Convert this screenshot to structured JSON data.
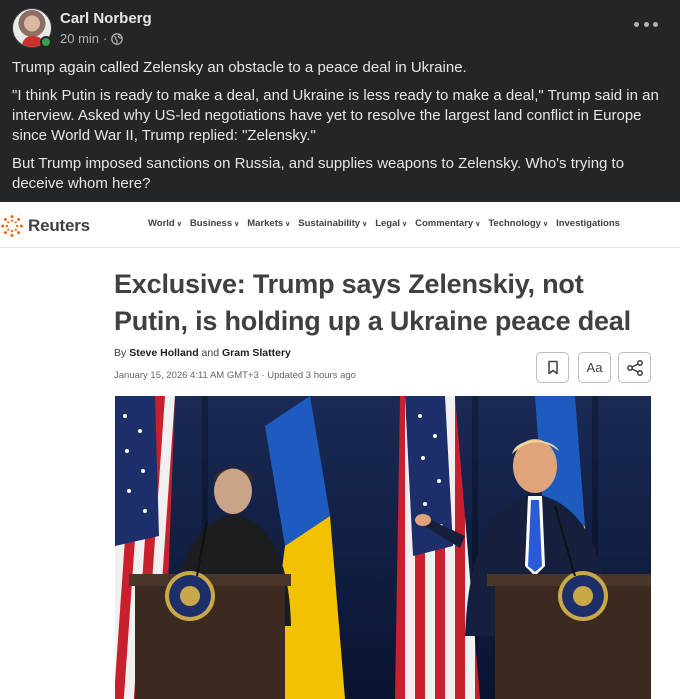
{
  "post": {
    "author": "Carl Norberg",
    "time": "20 min",
    "separator": "·",
    "paragraphs": [
      "Trump again called Zelensky an obstacle to a peace deal in Ukraine.",
      "\"I think Putin is ready to make a deal, and Ukraine is less ready to make a deal,\" Trump said in an interview. Asked why US-led negotiations have yet to resolve the largest land conflict in Europe since World War II, Trump replied: \"Zelensky.\"",
      "But Trump imposed sanctions on Russia, and supplies weapons to Zelensky. Who's trying to deceive whom here?"
    ]
  },
  "article": {
    "brand": "Reuters",
    "nav": [
      "World",
      "Business",
      "Markets",
      "Sustainability",
      "Legal",
      "Commentary",
      "Technology",
      "Investigations"
    ],
    "headline": "Exclusive: Trump says Zelenskiy, not Putin, is holding up a Ukraine peace deal",
    "byline": {
      "prefix": "By",
      "author1": "Steve Holland",
      "conjunction": "and",
      "author2": "Gram Slattery"
    },
    "dateline": "January 15, 2026 4:11 AM GMT+3 · Updated 3 hours ago",
    "text_size_label": "Aa"
  },
  "colors": {
    "fb_bg": "#242526",
    "fb_text": "#e4e6eb",
    "fb_secondary": "#b0b3b8",
    "online": "#31a24c",
    "reuters_orange": "#fa6400",
    "headline": "#404040",
    "photo_bg": "#0d1a3a"
  },
  "icons": [
    "globe-icon",
    "more-options-icon",
    "bookmark-icon",
    "share-icon",
    "reuters-logo-icon"
  ]
}
